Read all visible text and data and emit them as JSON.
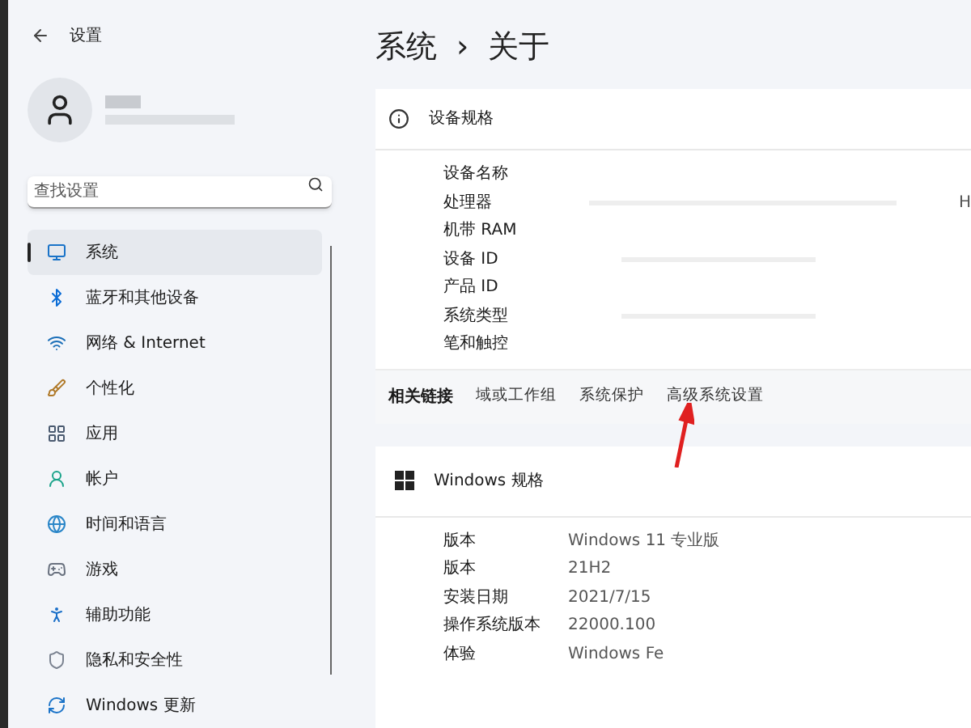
{
  "window": {
    "title": "设置"
  },
  "sidebar": {
    "search": {
      "placeholder": "查找设置"
    },
    "items": [
      {
        "label": "系统",
        "selected": true
      },
      {
        "label": "蓝牙和其他设备",
        "selected": false
      },
      {
        "label": "网络 & Internet",
        "selected": false
      },
      {
        "label": "个性化",
        "selected": false
      },
      {
        "label": "应用",
        "selected": false
      },
      {
        "label": "帐户",
        "selected": false
      },
      {
        "label": "时间和语言",
        "selected": false
      },
      {
        "label": "游戏",
        "selected": false
      },
      {
        "label": "辅助功能",
        "selected": false
      },
      {
        "label": "隐私和安全性",
        "selected": false
      },
      {
        "label": "Windows 更新",
        "selected": false
      }
    ]
  },
  "breadcrumb": {
    "parent": "系统",
    "separator": "›",
    "current": "关于"
  },
  "device_specs": {
    "title": "设备规格",
    "rows": [
      "设备名称",
      "处理器",
      "机带 RAM",
      "设备 ID",
      "产品 ID",
      "系统类型",
      "笔和触控"
    ],
    "partial_value": "H"
  },
  "related_links": {
    "label": "相关链接",
    "links": [
      "域或工作组",
      "系统保护",
      "高级系统设置"
    ]
  },
  "windows_specs": {
    "title": "Windows 规格",
    "rows": [
      {
        "label": "版本",
        "value": "Windows 11 专业版"
      },
      {
        "label": "版本",
        "value": "21H2"
      },
      {
        "label": "安装日期",
        "value": "2021/7/15"
      },
      {
        "label": "操作系统版本",
        "value": "22000.100"
      },
      {
        "label": "体验",
        "value": "Windows Fe"
      }
    ]
  }
}
